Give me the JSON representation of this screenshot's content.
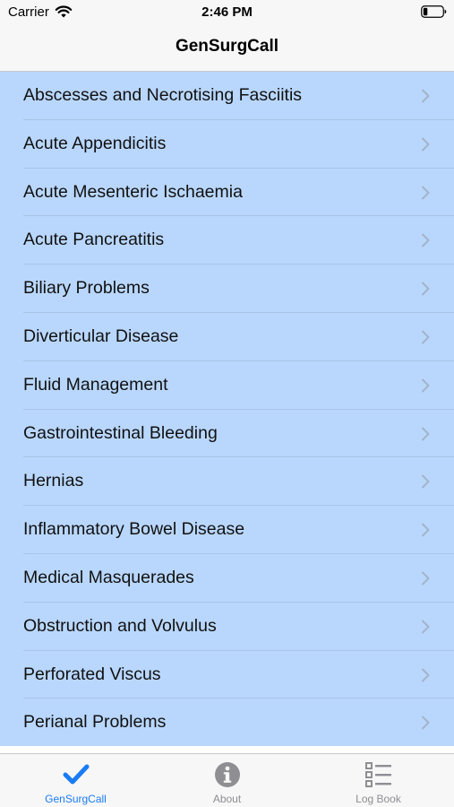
{
  "status_bar": {
    "carrier": "Carrier",
    "time": "2:46 PM"
  },
  "nav": {
    "title": "GenSurgCall"
  },
  "topics": [
    {
      "label": "Abscesses and Necrotising Fasciitis"
    },
    {
      "label": "Acute Appendicitis"
    },
    {
      "label": "Acute Mesenteric Ischaemia"
    },
    {
      "label": "Acute Pancreatitis"
    },
    {
      "label": "Biliary Problems"
    },
    {
      "label": "Diverticular Disease"
    },
    {
      "label": "Fluid Management"
    },
    {
      "label": "Gastrointestinal Bleeding"
    },
    {
      "label": "Hernias"
    },
    {
      "label": "Inflammatory Bowel Disease"
    },
    {
      "label": "Medical Masquerades"
    },
    {
      "label": "Obstruction and Volvulus"
    },
    {
      "label": "Perforated Viscus"
    },
    {
      "label": "Perianal Problems"
    }
  ],
  "tabs": [
    {
      "label": "GenSurgCall",
      "icon": "checkmark-icon",
      "selected": true
    },
    {
      "label": "About",
      "icon": "info-icon",
      "selected": false
    },
    {
      "label": "Log Book",
      "icon": "list-icon",
      "selected": false
    }
  ],
  "colors": {
    "list_background": "#b9d7fd",
    "accent": "#1a7cf5",
    "inactive_tab": "#8e8e93",
    "bar_background": "#f7f7f7"
  }
}
